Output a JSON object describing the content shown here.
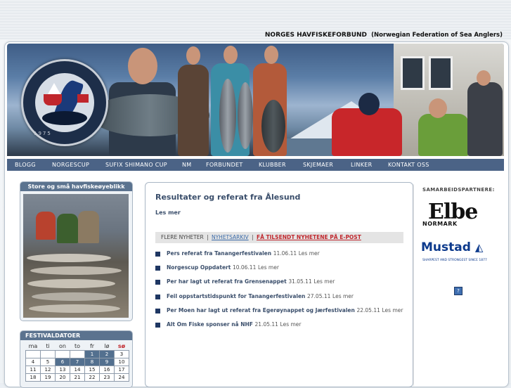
{
  "site": {
    "title": "NORGES HAVFISKEFORBUND",
    "subtitle": "(Norwegian Federation of Sea Anglers)",
    "logo_year": "1975"
  },
  "nav": {
    "items": [
      "BLOGG",
      "NORGESCUP",
      "SUFIX SHIMANO CUP",
      "NM",
      "FORBUNDET",
      "KLUBBER",
      "SKJEMAER",
      "LINKER",
      "KONTAKT OSS"
    ]
  },
  "gallery": {
    "header": "Store og små havfiskeøyeblikk"
  },
  "calendar": {
    "header": "FESTIVALDATOER",
    "weekdays": [
      "ma",
      "ti",
      "on",
      "to",
      "fr",
      "lø",
      "sø"
    ],
    "weeks": [
      [
        "",
        "",
        "",
        "",
        "1",
        "2",
        "3"
      ],
      [
        "4",
        "5",
        "6",
        "7",
        "8",
        "9",
        "10"
      ],
      [
        "11",
        "12",
        "13",
        "14",
        "15",
        "16",
        "17"
      ],
      [
        "18",
        "19",
        "20",
        "21",
        "22",
        "23",
        "24"
      ]
    ],
    "event_days": [
      "1",
      "2",
      "6",
      "7",
      "8",
      "9"
    ]
  },
  "main": {
    "headline": "Resultater og referat fra Ålesund",
    "read_more": "Les mer",
    "more_news_label": "FLERE NYHETER",
    "separator": "|",
    "archive_link": "NYHETSARKIV",
    "email_link": "FÅ TILSENDT NYHETENE PÅ E-POST",
    "news": [
      {
        "title": "Pers referat fra Tanangerfestivalen",
        "date": "11.06.11",
        "more": "Les mer"
      },
      {
        "title": "Norgescup Oppdatert",
        "date": "10.06.11",
        "more": "Les mer"
      },
      {
        "title": "Per har lagt ut referat fra Grensenappet",
        "date": "31.05.11",
        "more": "Les mer"
      },
      {
        "title": "Feil oppstartstidspunkt for Tanangerfestivalen",
        "date": "27.05.11",
        "more": "Les mer"
      },
      {
        "title": "Per Moen har lagt ut referat fra Egerøynappet og Jærfestivalen",
        "date": "22.05.11",
        "more": "Les mer"
      },
      {
        "title": "Alt Om Fiske sponser nå NHF",
        "date": "21.05.11",
        "more": "Les mer"
      }
    ]
  },
  "partners": {
    "title": "SAMARBEIDSPARTNERE:",
    "elbe": "Elbe",
    "normark": "NORMARK",
    "mustad": "Mustad",
    "mustad_tagline": "SHARPEST AND STRONGEST SINCE 1877"
  },
  "colors": {
    "nav_bg": "#4b6386",
    "box_header": "#5b738f",
    "headline": "#3a4e6b",
    "alert_red": "#c0262c",
    "bullet": "#1f3763",
    "calendar_event": "#53708f"
  }
}
